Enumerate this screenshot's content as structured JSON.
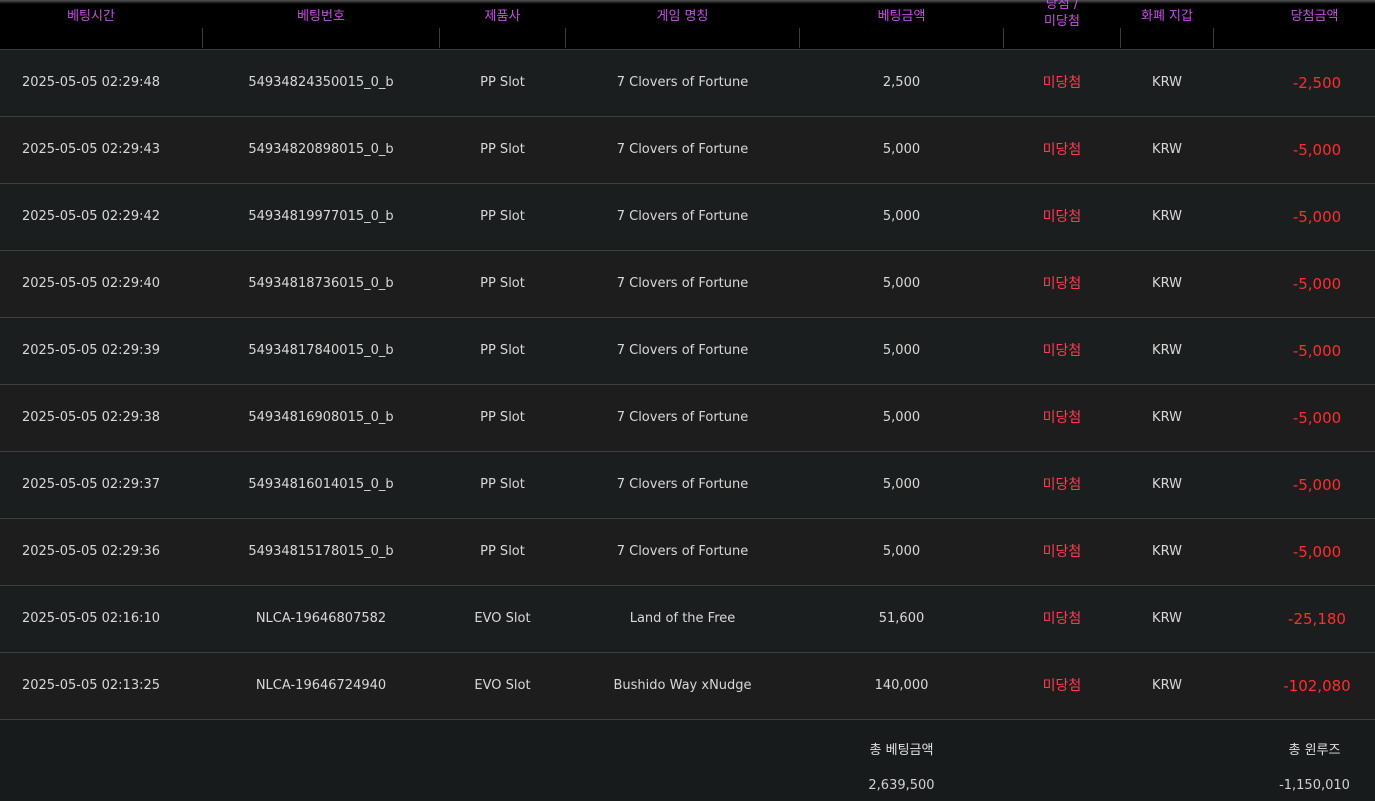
{
  "headers": {
    "bet_time": "베팅시간",
    "bet_number": "베팅번호",
    "provider": "제품사",
    "game_name": "게임 명칭",
    "bet_amount": "베팅금액",
    "result_line1": "당첨 /",
    "result_line2": "미당첨",
    "currency_wallet": "화폐 지갑",
    "win_amount": "당첨금액"
  },
  "rows": [
    {
      "time": "2025-05-05 02:29:48",
      "bet_no": "54934824350015_0_b",
      "provider": "PP Slot",
      "game": "7 Clovers of Fortune",
      "amount": "2,500",
      "result": "미당첨",
      "currency": "KRW",
      "win": "-2,500"
    },
    {
      "time": "2025-05-05 02:29:43",
      "bet_no": "54934820898015_0_b",
      "provider": "PP Slot",
      "game": "7 Clovers of Fortune",
      "amount": "5,000",
      "result": "미당첨",
      "currency": "KRW",
      "win": "-5,000"
    },
    {
      "time": "2025-05-05 02:29:42",
      "bet_no": "54934819977015_0_b",
      "provider": "PP Slot",
      "game": "7 Clovers of Fortune",
      "amount": "5,000",
      "result": "미당첨",
      "currency": "KRW",
      "win": "-5,000"
    },
    {
      "time": "2025-05-05 02:29:40",
      "bet_no": "54934818736015_0_b",
      "provider": "PP Slot",
      "game": "7 Clovers of Fortune",
      "amount": "5,000",
      "result": "미당첨",
      "currency": "KRW",
      "win": "-5,000"
    },
    {
      "time": "2025-05-05 02:29:39",
      "bet_no": "54934817840015_0_b",
      "provider": "PP Slot",
      "game": "7 Clovers of Fortune",
      "amount": "5,000",
      "result": "미당첨",
      "currency": "KRW",
      "win": "-5,000"
    },
    {
      "time": "2025-05-05 02:29:38",
      "bet_no": "54934816908015_0_b",
      "provider": "PP Slot",
      "game": "7 Clovers of Fortune",
      "amount": "5,000",
      "result": "미당첨",
      "currency": "KRW",
      "win": "-5,000"
    },
    {
      "time": "2025-05-05 02:29:37",
      "bet_no": "54934816014015_0_b",
      "provider": "PP Slot",
      "game": "7 Clovers of Fortune",
      "amount": "5,000",
      "result": "미당첨",
      "currency": "KRW",
      "win": "-5,000"
    },
    {
      "time": "2025-05-05 02:29:36",
      "bet_no": "54934815178015_0_b",
      "provider": "PP Slot",
      "game": "7 Clovers of Fortune",
      "amount": "5,000",
      "result": "미당첨",
      "currency": "KRW",
      "win": "-5,000"
    },
    {
      "time": "2025-05-05 02:16:10",
      "bet_no": "NLCA-19646807582",
      "provider": "EVO Slot",
      "game": "Land of the Free",
      "amount": "51,600",
      "result": "미당첨",
      "currency": "KRW",
      "win": "-25,180"
    },
    {
      "time": "2025-05-05 02:13:25",
      "bet_no": "NLCA-19646724940",
      "provider": "EVO Slot",
      "game": "Bushido Way xNudge",
      "amount": "140,000",
      "result": "미당첨",
      "currency": "KRW",
      "win": "-102,080"
    }
  ],
  "footer": {
    "total_bet_label": "총 베팅금액",
    "total_bet_value": "2,639,500",
    "total_winloss_label": "총 윈루즈",
    "total_winloss_value": "-1,150,010"
  },
  "colors": {
    "header_text": "#c94ee8",
    "loss_text": "#ff3b4f",
    "header_bg": "#000000"
  }
}
